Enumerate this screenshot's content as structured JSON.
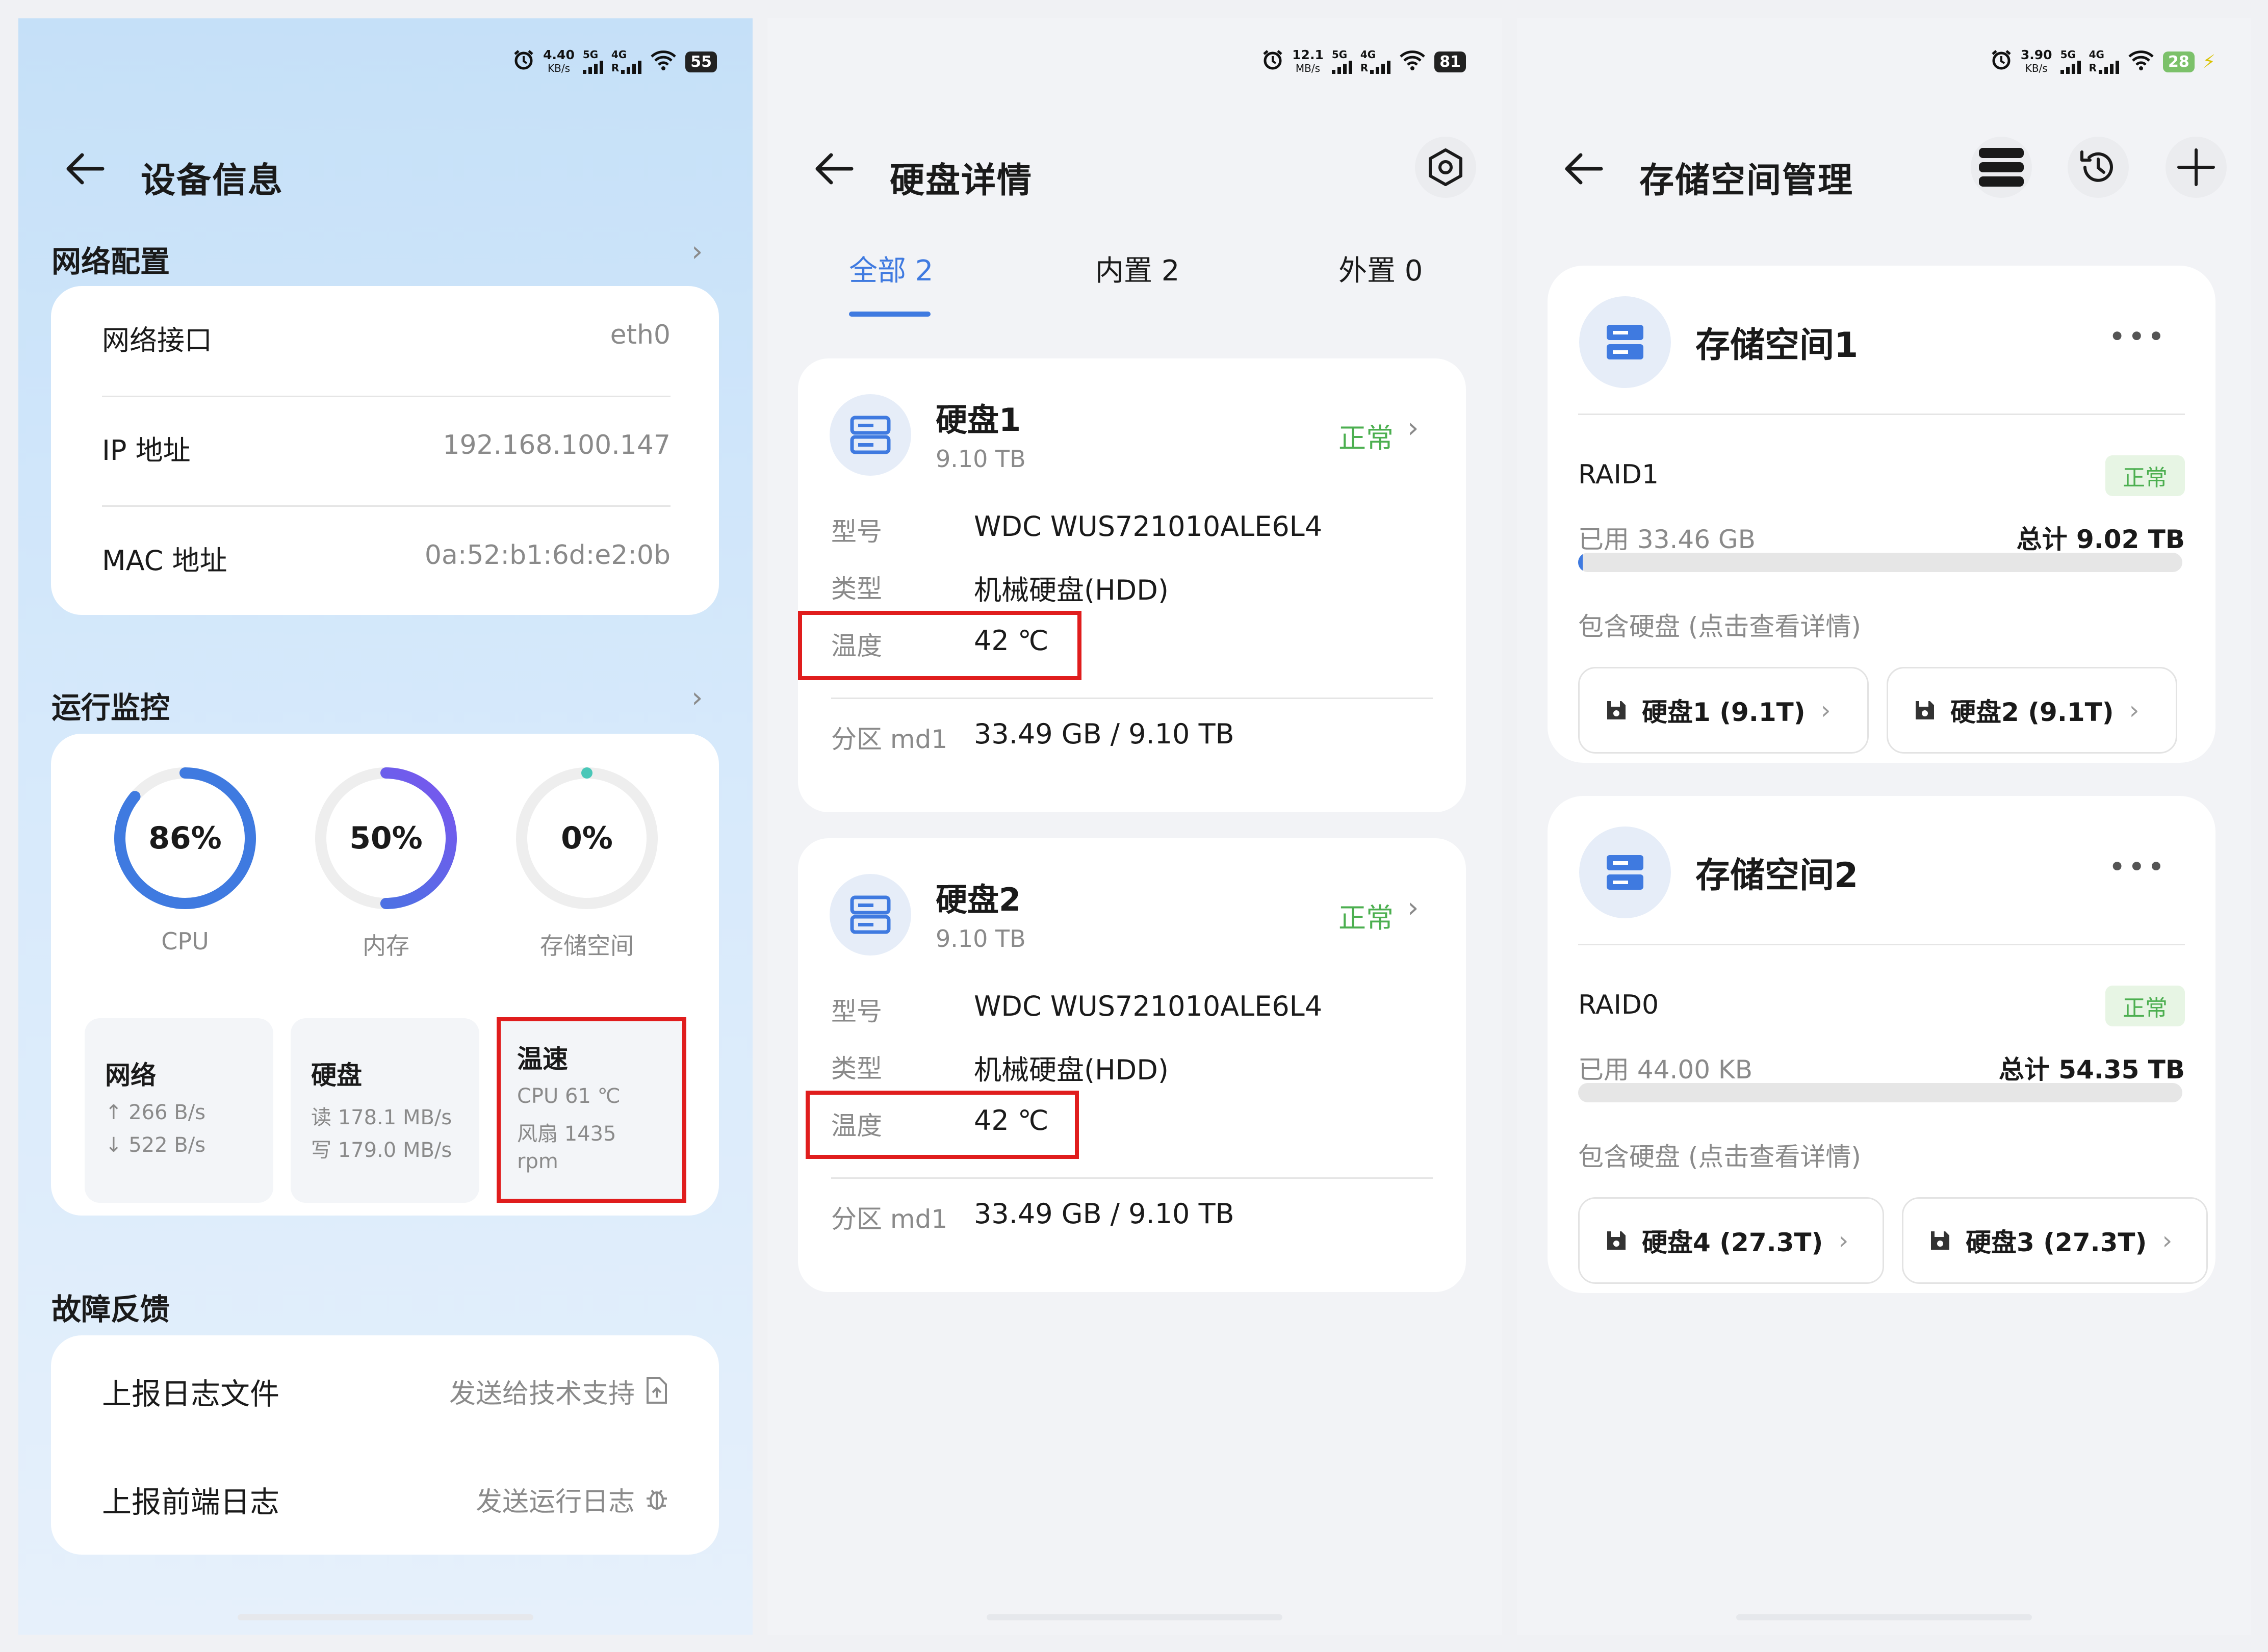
{
  "colors": {
    "accent": "#3f7ae0",
    "ok": "#4caf50",
    "highlight": "#e01d1d",
    "ring_purple": "#6b5cf0",
    "teal": "#4ac7b8"
  },
  "panel1": {
    "status": {
      "speed": "4.40",
      "speed_unit": "KB/s",
      "sig1": "5G",
      "sig2": "4G",
      "sig2b": "R",
      "battery": "55"
    },
    "title": "设备信息",
    "network": {
      "section": "网络配置",
      "rows": [
        {
          "label": "网络接口",
          "value": "eth0"
        },
        {
          "label": "IP 地址",
          "value": "192.168.100.147"
        },
        {
          "label": "MAC 地址",
          "value": "0a:52:b1:6d:e2:0b"
        }
      ]
    },
    "monitor": {
      "section": "运行监控",
      "rings": [
        {
          "value": "86%",
          "label": "CPU",
          "fraction": 0.86
        },
        {
          "value": "50%",
          "label": "内存",
          "fraction": 0.5
        },
        {
          "value": "0%",
          "label": "存储空间",
          "fraction": 0.0
        }
      ],
      "net": {
        "title": "网络",
        "up": "↑ 266 B/s",
        "down": "↓ 522 B/s"
      },
      "disk": {
        "title": "硬盘",
        "read": "读 178.1 MB/s",
        "write": "写 179.0 MB/s"
      },
      "temp": {
        "title": "温速",
        "cpu": "CPU 61 ℃",
        "fan": "风扇 1435",
        "unit": "rpm"
      }
    },
    "feedback": {
      "section": "故障反馈",
      "rows": [
        {
          "label": "上报日志文件",
          "value": "发送给技术支持",
          "icon": "upload-file-icon"
        },
        {
          "label": "上报前端日志",
          "value": "发送运行日志",
          "icon": "bug-icon"
        }
      ]
    }
  },
  "panel2": {
    "status": {
      "speed": "12.1",
      "speed_unit": "MB/s",
      "sig1": "5G",
      "sig2": "4G",
      "sig2b": "R",
      "battery": "81"
    },
    "title": "硬盘详情",
    "tabs": [
      {
        "label": "全部 2"
      },
      {
        "label": "内置 2"
      },
      {
        "label": "外置 0"
      }
    ],
    "disks": [
      {
        "name": "硬盘1",
        "size": "9.10 TB",
        "status": "正常",
        "model_label": "型号",
        "model": "WDC WUS721010ALE6L4",
        "type_label": "类型",
        "type": "机械硬盘(HDD)",
        "temp_label": "温度",
        "temp": "42 ℃",
        "part_label": "分区 md1",
        "part": "33.49 GB / 9.10 TB"
      },
      {
        "name": "硬盘2",
        "size": "9.10 TB",
        "status": "正常",
        "model_label": "型号",
        "model": "WDC WUS721010ALE6L4",
        "type_label": "类型",
        "type": "机械硬盘(HDD)",
        "temp_label": "温度",
        "temp": "42 ℃",
        "part_label": "分区 md1",
        "part": "33.49 GB / 9.10 TB"
      }
    ]
  },
  "panel3": {
    "status": {
      "speed": "3.90",
      "speed_unit": "KB/s",
      "sig1": "5G",
      "sig2": "4G",
      "sig2b": "R",
      "battery": "28"
    },
    "title": "存储空间管理",
    "spaces": [
      {
        "name": "存储空间1",
        "raid": "RAID1",
        "status": "正常",
        "used": "已用 33.46 GB",
        "total": "总计 9.02 TB",
        "fraction": 0.004,
        "contains": "包含硬盘 (点击查看详情)",
        "chips": [
          {
            "label": "硬盘1 (9.1T)"
          },
          {
            "label": "硬盘2 (9.1T)"
          }
        ]
      },
      {
        "name": "存储空间2",
        "raid": "RAID0",
        "status": "正常",
        "used": "已用 44.00 KB",
        "total": "总计 54.35 TB",
        "fraction": 0.0,
        "contains": "包含硬盘 (点击查看详情)",
        "chips": [
          {
            "label": "硬盘4 (27.3T)"
          },
          {
            "label": "硬盘3 (27.3T)"
          }
        ]
      }
    ]
  }
}
